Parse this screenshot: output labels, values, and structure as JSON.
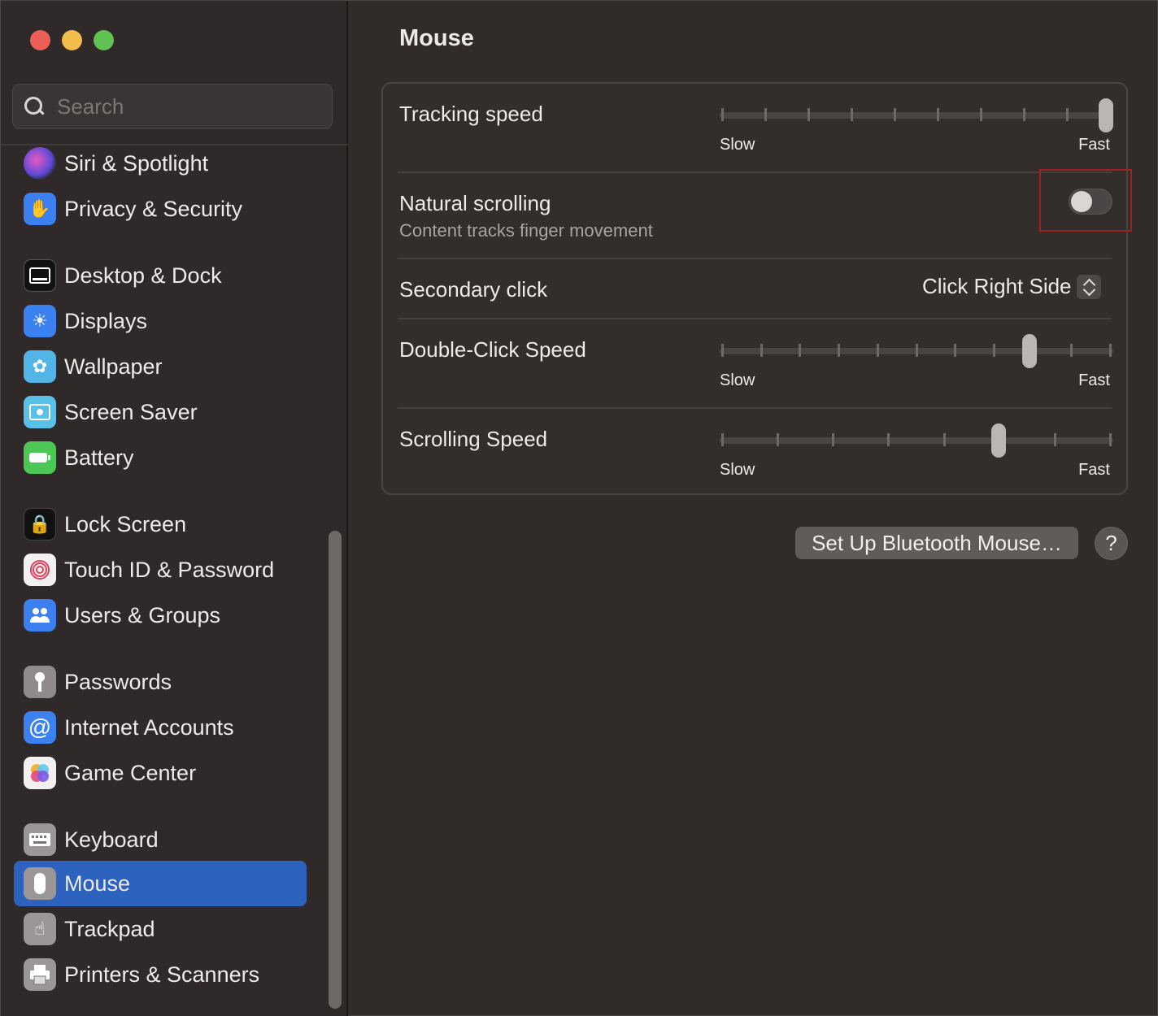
{
  "window": {
    "title": "Mouse"
  },
  "search": {
    "placeholder": "Search"
  },
  "sidebar": {
    "items": [
      {
        "label": "Siri & Spotlight",
        "icon": "siri-icon",
        "color": "#7b3fd1"
      },
      {
        "label": "Privacy & Security",
        "icon": "hand-icon",
        "color": "#3b7ff0"
      },
      {
        "label": "Desktop & Dock",
        "icon": "dock-icon",
        "color": "#1c1c1e"
      },
      {
        "label": "Displays",
        "icon": "sun-icon",
        "color": "#3b82f0"
      },
      {
        "label": "Wallpaper",
        "icon": "flower-icon",
        "color": "#53b4e6"
      },
      {
        "label": "Screen Saver",
        "icon": "screensaver-icon",
        "color": "#59c0e8"
      },
      {
        "label": "Battery",
        "icon": "battery-icon",
        "color": "#4cc756"
      },
      {
        "label": "Lock Screen",
        "icon": "lock-icon",
        "color": "#1c1c1e"
      },
      {
        "label": "Touch ID & Password",
        "icon": "fingerprint-icon",
        "color": "#f2f0f0"
      },
      {
        "label": "Users & Groups",
        "icon": "users-icon",
        "color": "#3b7ff0"
      },
      {
        "label": "Passwords",
        "icon": "key-icon",
        "color": "#8e8b8a"
      },
      {
        "label": "Internet Accounts",
        "icon": "at-icon",
        "color": "#3b82f0"
      },
      {
        "label": "Game Center",
        "icon": "game-center-icon",
        "color": "#f2f0f0"
      },
      {
        "label": "Keyboard",
        "icon": "keyboard-icon",
        "color": "#9a9796"
      },
      {
        "label": "Mouse",
        "icon": "mouse-icon",
        "color": "#9a9796",
        "active": true
      },
      {
        "label": "Trackpad",
        "icon": "trackpad-icon",
        "color": "#9a9796"
      },
      {
        "label": "Printers & Scanners",
        "icon": "printer-icon",
        "color": "#9a9796"
      }
    ]
  },
  "settings": {
    "tracking_speed": {
      "label": "Tracking speed",
      "min_label": "Slow",
      "max_label": "Fast",
      "value_fraction": 1.0
    },
    "natural_scrolling": {
      "label": "Natural scrolling",
      "sublabel": "Content tracks finger movement",
      "enabled": false
    },
    "secondary_click": {
      "label": "Secondary click",
      "value": "Click Right Side"
    },
    "double_click_speed": {
      "label": "Double-Click Speed",
      "min_label": "Slow",
      "max_label": "Fast",
      "value_fraction": 0.79
    },
    "scrolling_speed": {
      "label": "Scrolling Speed",
      "min_label": "Slow",
      "max_label": "Fast",
      "value_fraction": 0.71
    }
  },
  "buttons": {
    "setup_bluetooth": "Set Up Bluetooth Mouse…",
    "help": "?"
  },
  "colors": {
    "accent": "#2e62bf",
    "highlight_box": "#9b2421"
  }
}
